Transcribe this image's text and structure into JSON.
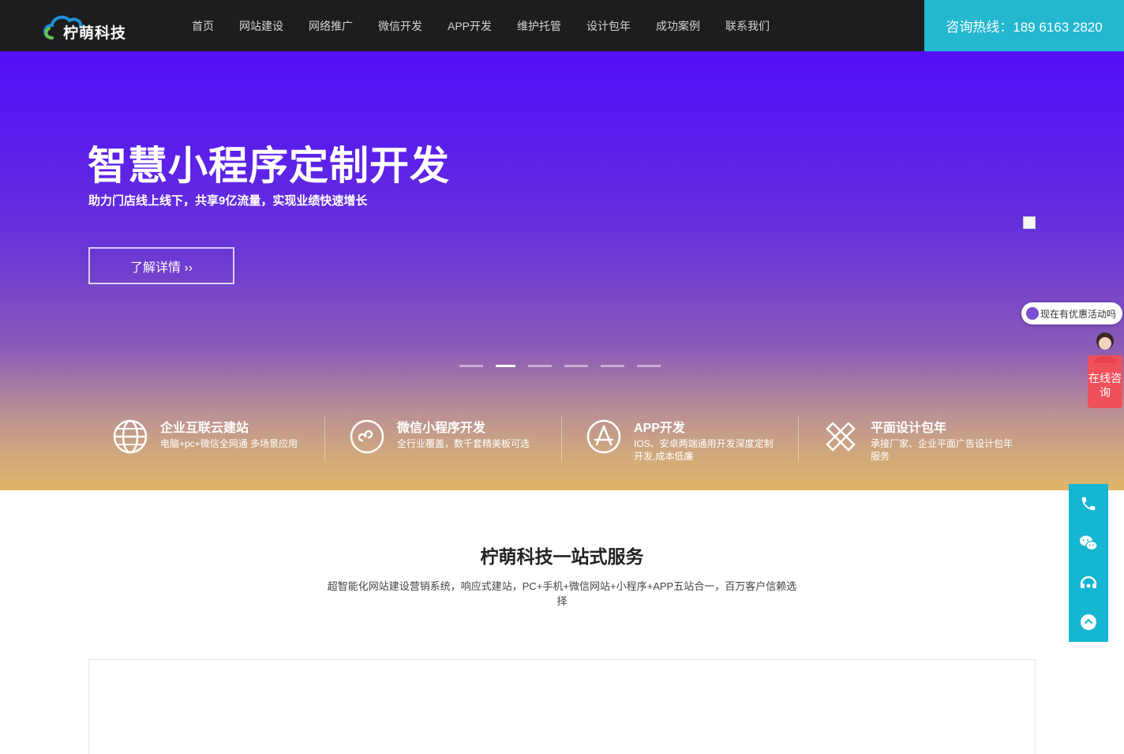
{
  "header": {
    "logo_text": "柠萌科技",
    "nav": [
      "首页",
      "网站建设",
      "网络推广",
      "微信开发",
      "APP开发",
      "维护托管",
      "设计包年",
      "成功案例",
      "联系我们"
    ],
    "hotline": "咨询热线：189 6163 2820"
  },
  "hero": {
    "title": "智慧小程序定制开发",
    "subtitle": "助力门店线上线下，共享9亿流量，实现业绩快速增长",
    "button": "了解详情 ››",
    "slide_count": 6,
    "active_slide": 2
  },
  "features": [
    {
      "icon": "globe-icon",
      "title": "企业互联云建站",
      "desc": "电脑+pc+微信全网通 多场景应用"
    },
    {
      "icon": "miniprogram-icon",
      "title": "微信小程序开发",
      "desc": "全行业覆盖，数千套精美板可选"
    },
    {
      "icon": "appstore-icon",
      "title": "APP开发",
      "desc": "IOS、安卓两端通用开发深度定制开发,成本低廉"
    },
    {
      "icon": "design-tools-icon",
      "title": "平面设计包年",
      "desc": "承接厂家、企业平面广告设计包年服务"
    }
  ],
  "service": {
    "title": "柠萌科技一站式服务",
    "desc": "超智能化网站建设营销系统，响应式建站，PC+手机+微信网站+小程序+APP五站合一，百万客户信赖选择"
  },
  "chat": {
    "bubble": "现在有优惠活动吗",
    "consult": "在线咨询"
  },
  "side_tools": [
    "phone-icon",
    "wechat-icon",
    "service-icon",
    "back-to-top-icon"
  ],
  "colors": {
    "header_bg": "#1d1d1f",
    "hotline_bg": "#23b7d0",
    "side_bg": "#14b6d1",
    "consult_bg": "#f0505a"
  }
}
